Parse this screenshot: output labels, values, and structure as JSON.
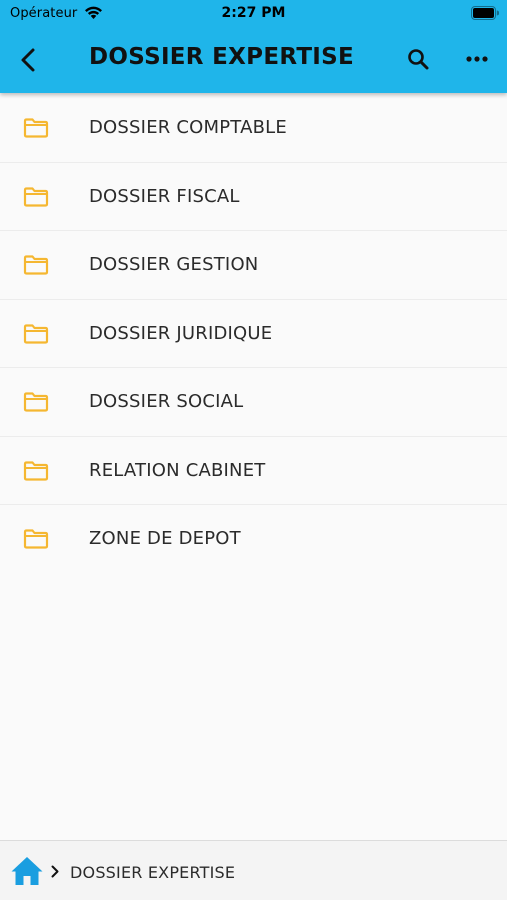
{
  "status_bar": {
    "carrier": "Opérateur",
    "time": "2:27 PM"
  },
  "header": {
    "title": "DOSSIER EXPERTISE",
    "icons": [
      "back-icon",
      "search-icon",
      "more-icon"
    ],
    "background_color": "#1fb5ea"
  },
  "folders": [
    {
      "label": "DOSSIER COMPTABLE"
    },
    {
      "label": "DOSSIER FISCAL"
    },
    {
      "label": "DOSSIER GESTION"
    },
    {
      "label": "DOSSIER JURIDIQUE"
    },
    {
      "label": "DOSSIER SOCIAL"
    },
    {
      "label": "RELATION CABINET"
    },
    {
      "label": "ZONE DE DEPOT"
    }
  ],
  "folder_icon_color": "#f5b731",
  "breadcrumb": {
    "home_icon": "home-icon",
    "home_icon_color": "#1a9ee0",
    "current": "DOSSIER EXPERTISE"
  }
}
